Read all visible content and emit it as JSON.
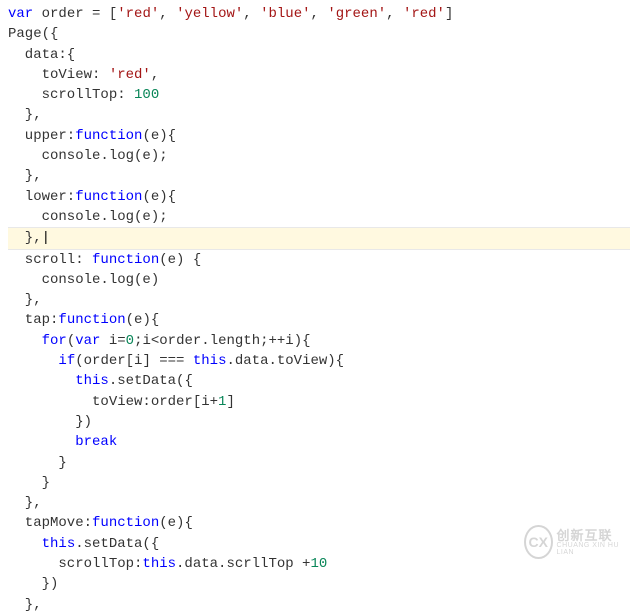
{
  "code": {
    "lines": [
      {
        "segments": [
          {
            "cls": "kw",
            "t": "var"
          },
          {
            "cls": "pln",
            "t": " order = ["
          },
          {
            "cls": "str",
            "t": "'red'"
          },
          {
            "cls": "pln",
            "t": ", "
          },
          {
            "cls": "str",
            "t": "'yellow'"
          },
          {
            "cls": "pln",
            "t": ", "
          },
          {
            "cls": "str",
            "t": "'blue'"
          },
          {
            "cls": "pln",
            "t": ", "
          },
          {
            "cls": "str",
            "t": "'green'"
          },
          {
            "cls": "pln",
            "t": ", "
          },
          {
            "cls": "str",
            "t": "'red'"
          },
          {
            "cls": "pln",
            "t": "]"
          }
        ]
      },
      {
        "segments": [
          {
            "cls": "pln",
            "t": "Page({"
          }
        ]
      },
      {
        "segments": [
          {
            "cls": "pln",
            "t": "  data:{"
          }
        ]
      },
      {
        "segments": [
          {
            "cls": "pln",
            "t": "    toView: "
          },
          {
            "cls": "str",
            "t": "'red'"
          },
          {
            "cls": "pln",
            "t": ","
          }
        ]
      },
      {
        "segments": [
          {
            "cls": "pln",
            "t": "    scrollTop: "
          },
          {
            "cls": "num",
            "t": "100"
          }
        ]
      },
      {
        "segments": [
          {
            "cls": "pln",
            "t": "  },"
          }
        ]
      },
      {
        "segments": [
          {
            "cls": "pln",
            "t": "  upper:"
          },
          {
            "cls": "kw",
            "t": "function"
          },
          {
            "cls": "pln",
            "t": "(e){"
          }
        ]
      },
      {
        "segments": [
          {
            "cls": "pln",
            "t": "    console.log(e);"
          }
        ]
      },
      {
        "segments": [
          {
            "cls": "pln",
            "t": "  },"
          }
        ]
      },
      {
        "segments": [
          {
            "cls": "pln",
            "t": "  lower:"
          },
          {
            "cls": "kw",
            "t": "function"
          },
          {
            "cls": "pln",
            "t": "(e){"
          }
        ]
      },
      {
        "segments": [
          {
            "cls": "pln",
            "t": "    console.log(e);"
          }
        ]
      },
      {
        "hl": true,
        "segments": [
          {
            "cls": "pln",
            "t": "  },"
          },
          {
            "cls": "cursor",
            "t": "|"
          }
        ]
      },
      {
        "segments": [
          {
            "cls": "pln",
            "t": "  scroll: "
          },
          {
            "cls": "kw",
            "t": "function"
          },
          {
            "cls": "pln",
            "t": "(e) {"
          }
        ]
      },
      {
        "segments": [
          {
            "cls": "pln",
            "t": "    console.log(e)"
          }
        ]
      },
      {
        "segments": [
          {
            "cls": "pln",
            "t": "  },"
          }
        ]
      },
      {
        "segments": [
          {
            "cls": "pln",
            "t": "  tap:"
          },
          {
            "cls": "kw",
            "t": "function"
          },
          {
            "cls": "pln",
            "t": "(e){"
          }
        ]
      },
      {
        "segments": [
          {
            "cls": "pln",
            "t": "    "
          },
          {
            "cls": "kw",
            "t": "for"
          },
          {
            "cls": "pln",
            "t": "("
          },
          {
            "cls": "kw",
            "t": "var"
          },
          {
            "cls": "pln",
            "t": " i="
          },
          {
            "cls": "num",
            "t": "0"
          },
          {
            "cls": "pln",
            "t": ";i<order.length;++i){"
          }
        ]
      },
      {
        "segments": [
          {
            "cls": "pln",
            "t": "      "
          },
          {
            "cls": "kw",
            "t": "if"
          },
          {
            "cls": "pln",
            "t": "(order[i] === "
          },
          {
            "cls": "kw",
            "t": "this"
          },
          {
            "cls": "pln",
            "t": ".data.toView){"
          }
        ]
      },
      {
        "segments": [
          {
            "cls": "pln",
            "t": "        "
          },
          {
            "cls": "kw",
            "t": "this"
          },
          {
            "cls": "pln",
            "t": ".setData({"
          }
        ]
      },
      {
        "segments": [
          {
            "cls": "pln",
            "t": "          toView:order[i+"
          },
          {
            "cls": "num",
            "t": "1"
          },
          {
            "cls": "pln",
            "t": "]"
          }
        ]
      },
      {
        "segments": [
          {
            "cls": "pln",
            "t": "        })"
          }
        ]
      },
      {
        "segments": [
          {
            "cls": "pln",
            "t": "        "
          },
          {
            "cls": "kw",
            "t": "break"
          }
        ]
      },
      {
        "segments": [
          {
            "cls": "pln",
            "t": "      }"
          }
        ]
      },
      {
        "segments": [
          {
            "cls": "pln",
            "t": "    }"
          }
        ]
      },
      {
        "segments": [
          {
            "cls": "pln",
            "t": "  },"
          }
        ]
      },
      {
        "segments": [
          {
            "cls": "pln",
            "t": "  tapMove:"
          },
          {
            "cls": "kw",
            "t": "function"
          },
          {
            "cls": "pln",
            "t": "(e){"
          }
        ]
      },
      {
        "segments": [
          {
            "cls": "pln",
            "t": "    "
          },
          {
            "cls": "kw",
            "t": "this"
          },
          {
            "cls": "pln",
            "t": ".setData({"
          }
        ]
      },
      {
        "segments": [
          {
            "cls": "pln",
            "t": "      scrollTop:"
          },
          {
            "cls": "kw",
            "t": "this"
          },
          {
            "cls": "pln",
            "t": ".data.scrllTop +"
          },
          {
            "cls": "num",
            "t": "10"
          }
        ]
      },
      {
        "segments": [
          {
            "cls": "pln",
            "t": "    })"
          }
        ]
      },
      {
        "segments": [
          {
            "cls": "pln",
            "t": "  },"
          }
        ]
      }
    ]
  },
  "watermark": {
    "logo_letter": "CX",
    "cn": "创新互联",
    "en": "CHUANG XIN HU LIAN"
  }
}
